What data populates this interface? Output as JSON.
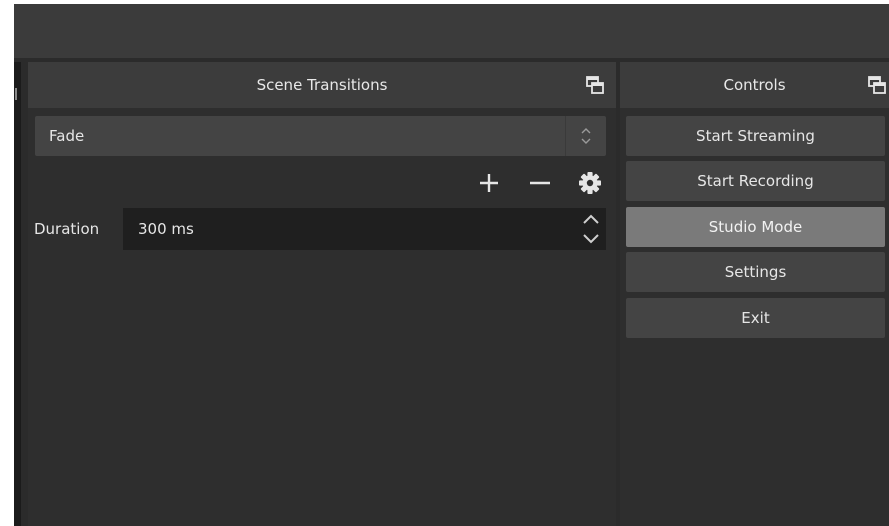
{
  "scene_transitions": {
    "title": "Scene Transitions",
    "transition_select": {
      "value": "Fade"
    },
    "duration": {
      "label": "Duration",
      "value": "300 ms"
    },
    "icons": {
      "float": "float-dock-icon",
      "add": "plus-icon",
      "remove": "minus-icon",
      "properties": "gear-icon"
    }
  },
  "controls": {
    "title": "Controls",
    "buttons": [
      {
        "label": "Start Streaming",
        "active": false
      },
      {
        "label": "Start Recording",
        "active": false
      },
      {
        "label": "Studio Mode",
        "active": true
      },
      {
        "label": "Settings",
        "active": false
      },
      {
        "label": "Exit",
        "active": false
      }
    ]
  },
  "colors": {
    "window_bg": "#2b2b2b",
    "dock_header": "#3c3c3c",
    "button_bg": "#444444",
    "button_active_bg": "#7a7a7a",
    "input_bg": "#1f1f1f",
    "text": "#e6e6e6"
  }
}
